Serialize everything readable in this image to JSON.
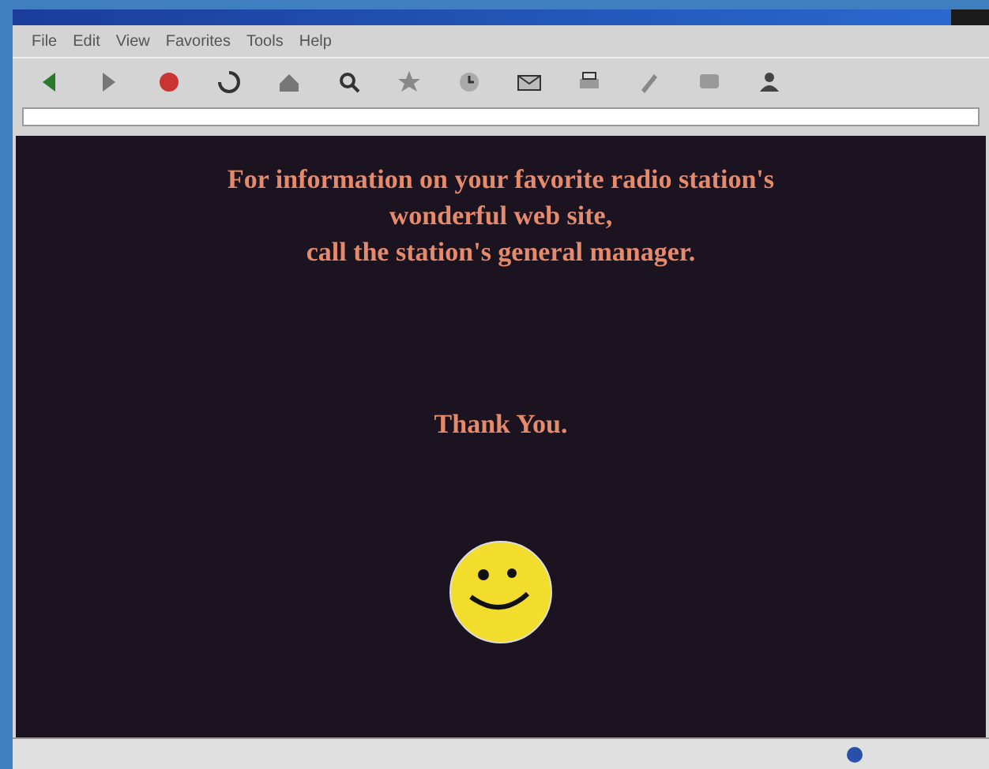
{
  "menu": [
    {
      "label": "File"
    },
    {
      "label": "Edit"
    },
    {
      "label": "View"
    },
    {
      "label": "Favorites"
    },
    {
      "label": "Tools"
    },
    {
      "label": "Help"
    }
  ],
  "toolbar": [
    {
      "kind": "back"
    },
    {
      "kind": "forward"
    },
    {
      "kind": "stop"
    },
    {
      "kind": "refresh"
    },
    {
      "kind": "home"
    },
    {
      "kind": "search"
    },
    {
      "kind": "favorites"
    },
    {
      "kind": "history"
    },
    {
      "kind": "mail"
    },
    {
      "kind": "print"
    },
    {
      "kind": "edit"
    },
    {
      "kind": "discuss"
    },
    {
      "kind": "messenger"
    }
  ],
  "content": {
    "message_lines": [
      "For information on your favorite radio station's",
      "wonderful web site,",
      "call the station's general manager."
    ],
    "thanks": "Thank You."
  }
}
